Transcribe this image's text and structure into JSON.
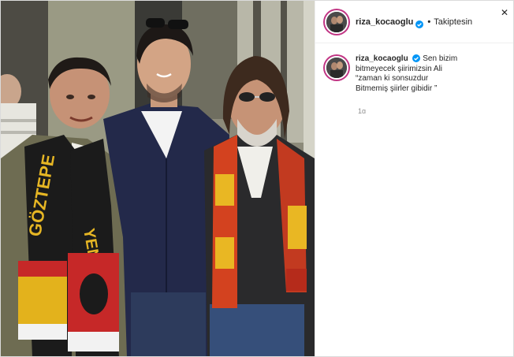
{
  "post": {
    "username": "riza_kocaoglu",
    "follow_status": "Takiptesin",
    "separator": "•",
    "close_glyph": "✕",
    "caption": {
      "username": "riza_kocaoglu",
      "first_line": "Sen bizim",
      "lines": [
        "bitmeyecek şiirimizsin Ali",
        "“zaman ki sonsuzdur",
        "Bitmemiş şiirler gibidir ”"
      ]
    },
    "age": "1g",
    "icons": {
      "verified": "verified-badge-icon",
      "close": "close-icon"
    },
    "colors": {
      "accent": "#0095f6",
      "story_ring": "#c13584",
      "muted": "#8e8e8e"
    }
  }
}
